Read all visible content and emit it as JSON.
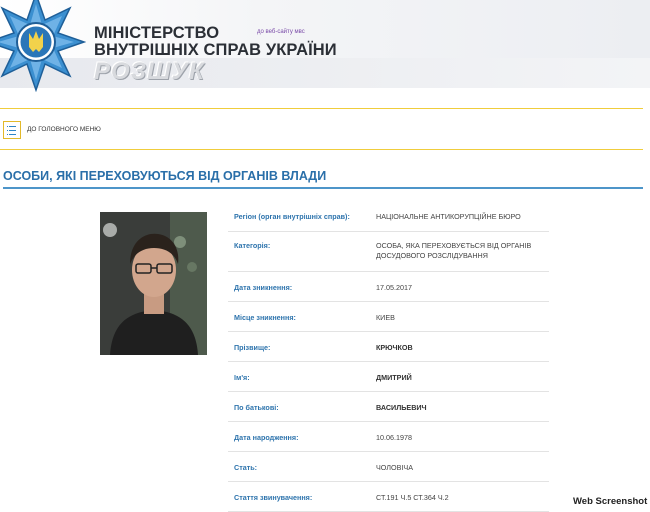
{
  "header": {
    "ministry_line1": "МІНІСТЕРСТВО",
    "ministry_line2": "ВНУТРІШНІХ СПРАВ УКРАЇНИ",
    "section_logo": "РОЗШУК",
    "site_link": "до веб-сайту мвс",
    "emblem_icon": "police-star-emblem-icon"
  },
  "menu": {
    "home_label": "ДО ГОЛОВНОГО МЕНЮ",
    "menu_icon": "list-menu-icon"
  },
  "page": {
    "title": "ОСОБИ, ЯКІ ПЕРЕХОВУЮТЬСЯ ВІД ОРГАНІВ ВЛАДИ"
  },
  "person": {
    "photo_icon": "person-photo",
    "fields": [
      {
        "label": "Регіон (орган внутрішніх справ):",
        "value": "НАЦІОНАЛЬНЕ АНТИКОРУПЦІЙНЕ БЮРО",
        "bold": false
      },
      {
        "label": "Категорія:",
        "value_lines": [
          "ОСОБА, ЯКА ПЕРЕХОВУЄТЬСЯ ВІД ОРГАНІВ",
          "ДОСУДОВОГО РОЗСЛІДУВАННЯ"
        ],
        "bold": false
      },
      {
        "label": "Дата зникнення:",
        "value": "17.05.2017",
        "bold": false
      },
      {
        "label": "Місце зникнення:",
        "value": "КИЕВ",
        "bold": false
      },
      {
        "label": "Прізвище:",
        "value": "КРЮЧКОВ",
        "bold": true
      },
      {
        "label": "Ім'я:",
        "value": "ДМИТРИЙ",
        "bold": true
      },
      {
        "label": "По батькові:",
        "value": "ВАСИЛЬЕВИЧ",
        "bold": true
      },
      {
        "label": "Дата народження:",
        "value": "10.06.1978",
        "bold": false
      },
      {
        "label": "Стать:",
        "value": "ЧОЛОВІЧА",
        "bold": false
      },
      {
        "label": "Стаття звинувачення:",
        "value": "СТ.191 Ч.5 СТ.364 Ч.2",
        "bold": false
      }
    ]
  },
  "watermark": "Web Screenshot",
  "colors": {
    "accent_blue": "#2e74ad",
    "title_blue": "#2a6fa9",
    "rule_yellow": "#f0cd3c"
  }
}
